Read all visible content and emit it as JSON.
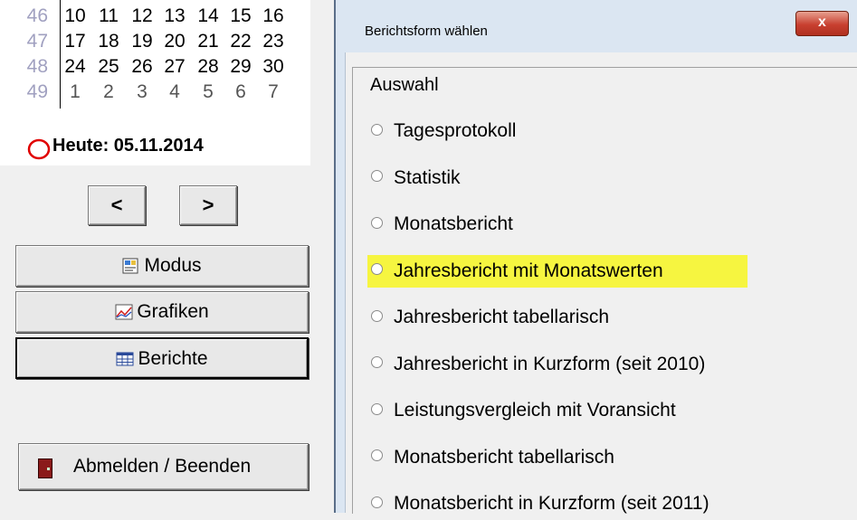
{
  "calendar": {
    "weeks": [
      {
        "week": "46",
        "days": [
          "10",
          "11",
          "12",
          "13",
          "14",
          "15",
          "16"
        ],
        "other": false
      },
      {
        "week": "47",
        "days": [
          "17",
          "18",
          "19",
          "20",
          "21",
          "22",
          "23"
        ],
        "other": false
      },
      {
        "week": "48",
        "days": [
          "24",
          "25",
          "26",
          "27",
          "28",
          "29",
          "30"
        ],
        "other": false
      },
      {
        "week": "49",
        "days": [
          "1",
          "2",
          "3",
          "4",
          "5",
          "6",
          "7"
        ],
        "other": true
      }
    ],
    "today_label": "Heute: 05.11.2014"
  },
  "nav": {
    "prev": "<",
    "next": ">"
  },
  "sidebar": {
    "modus": "Modus",
    "grafiken": "Grafiken",
    "berichte": "Berichte",
    "exit": "Abmelden / Beenden"
  },
  "dialog": {
    "title": "Berichtsform wählen",
    "close": "x",
    "group_label": "Auswahl",
    "options": [
      "Tagesprotokoll",
      "Statistik",
      "Monatsbericht",
      "Jahresbericht mit Monatswerten",
      "Jahresbericht tabellarisch",
      "Jahresbericht in Kurzform (seit 2010)",
      "Leistungsvergleich mit Voransicht",
      "Monatsbericht tabellarisch",
      "Monatsbericht in Kurzform (seit 2011)"
    ],
    "highlighted_index": 3,
    "highlight_color": "#f6f540"
  }
}
